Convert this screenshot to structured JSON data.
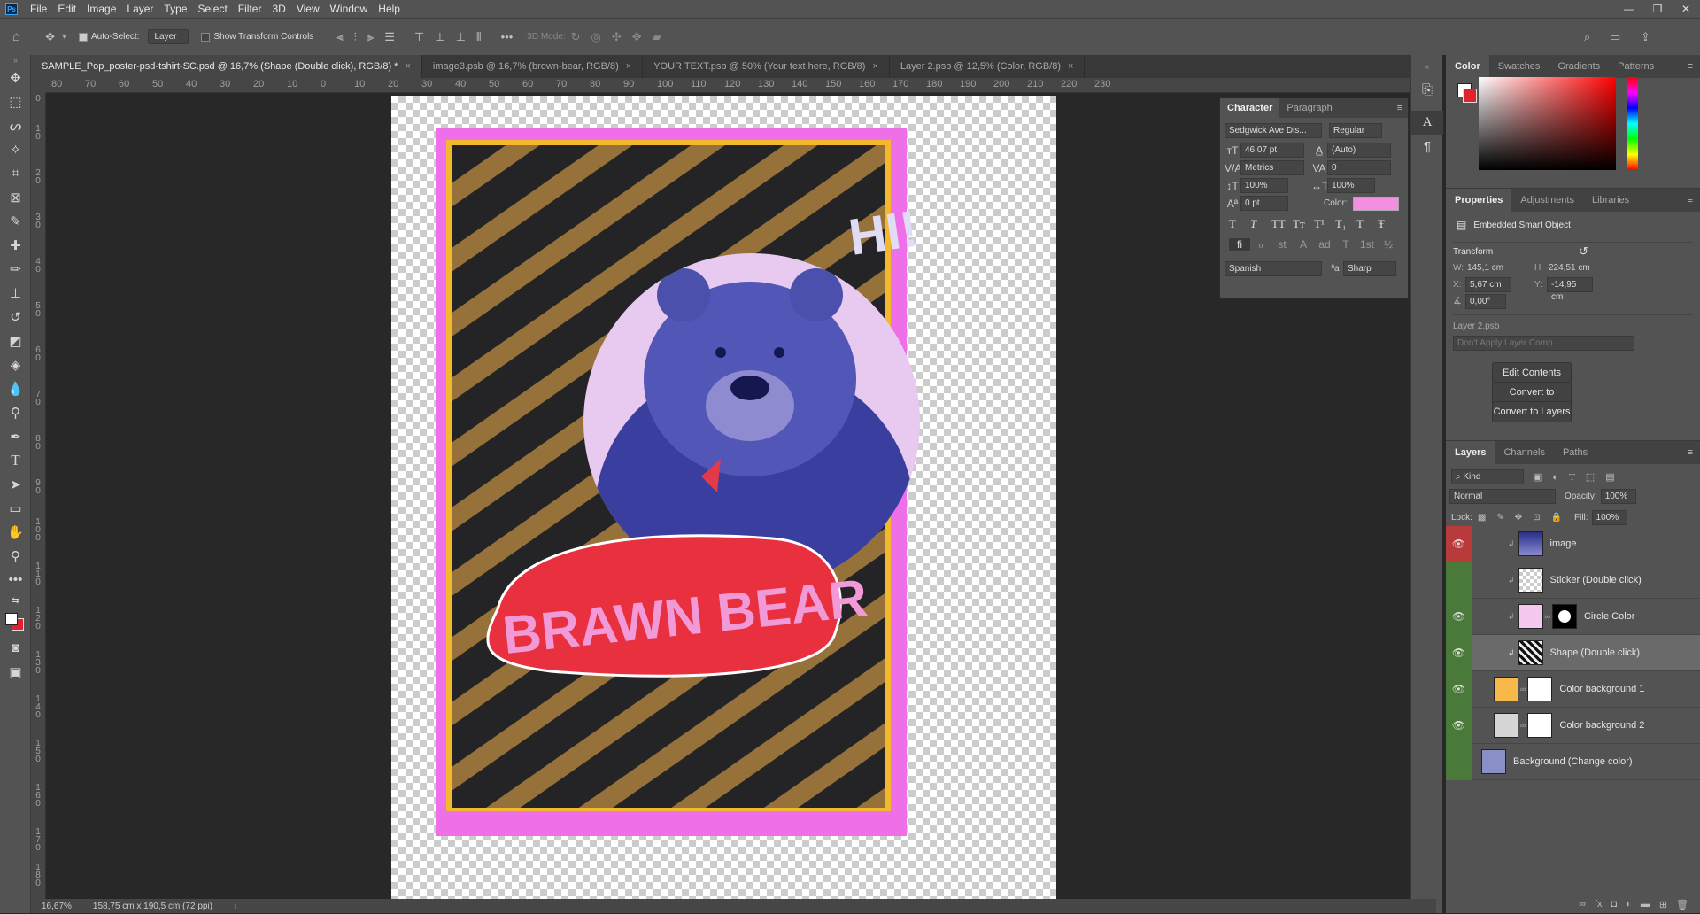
{
  "app": {
    "logo": "Ps"
  },
  "menu": [
    "File",
    "Edit",
    "Image",
    "Layer",
    "Type",
    "Select",
    "Filter",
    "3D",
    "View",
    "Window",
    "Help"
  ],
  "window_controls": [
    "—",
    "❐",
    "✕"
  ],
  "options": {
    "auto_select_label": "Auto-Select:",
    "auto_select_value": "Layer",
    "transform_controls_label": "Show Transform Controls",
    "mode_3d_label": "3D Mode:"
  },
  "doc_tabs": [
    {
      "title": "SAMPLE_Pop_poster-psd-tshirt-SC.psd @ 16,7% (Shape (Double click), RGB/8) *"
    },
    {
      "title": "image3.psb @ 16,7% (brown-bear, RGB/8)"
    },
    {
      "title": "YOUR TEXT.psb @ 50% (Your text here, RGB/8)"
    },
    {
      "title": "Layer 2.psb @ 12,5% (Color, RGB/8)"
    }
  ],
  "ruler_h_ticks": [
    "80",
    "70",
    "60",
    "50",
    "40",
    "30",
    "20",
    "10",
    "0",
    "10",
    "20",
    "30",
    "40",
    "50",
    "60",
    "70",
    "80",
    "90",
    "100",
    "110",
    "120",
    "130",
    "140",
    "150",
    "160",
    "170",
    "180",
    "190",
    "200",
    "210",
    "220",
    "230"
  ],
  "ruler_v_ticks": [
    "0",
    "10",
    "20",
    "30",
    "40",
    "50",
    "60",
    "70",
    "80",
    "90",
    "100",
    "110",
    "120",
    "130",
    "140",
    "150",
    "160",
    "170",
    "180"
  ],
  "poster": {
    "greeting": "HI!",
    "bubble_text": "BRAWN BEAR"
  },
  "status": {
    "zoom": "16,67%",
    "dimensions": "158,75 cm x 190,5 cm (72 ppi)"
  },
  "character_panel": {
    "tabs": [
      "Character",
      "Paragraph"
    ],
    "font_family": "Sedgwick Ave Dis...",
    "font_style": "Regular",
    "font_size": "46,07 pt",
    "leading": "(Auto)",
    "kerning": "Metrics",
    "tracking": "0",
    "vertical_scale": "100%",
    "horizontal_scale": "100%",
    "baseline_shift": "0 pt",
    "color_label": "Color:",
    "color_value": "#f28fe0",
    "style_buttons": [
      "T",
      "T",
      "TT",
      "Tт",
      "T¹",
      "T₁",
      "T",
      "Ŧ"
    ],
    "opentype_buttons": [
      "fi",
      "ℴ",
      "st",
      "A",
      "ad",
      "T",
      "1st",
      "½"
    ],
    "language": "Spanish",
    "aa_label": "ªa",
    "antialias": "Sharp"
  },
  "color_panel": {
    "tabs": [
      "Color",
      "Swatches",
      "Gradients",
      "Patterns"
    ],
    "foreground": "#ffffff",
    "background": "#e3202e"
  },
  "properties_panel": {
    "tabs": [
      "Properties",
      "Adjustments",
      "Libraries"
    ],
    "type": "Embedded Smart Object",
    "transform_label": "Transform",
    "w_label": "W:",
    "w_value": "145,1 cm",
    "h_label": "H:",
    "h_value": "224,51 cm",
    "x_label": "X:",
    "x_value": "5,67 cm",
    "y_label": "Y:",
    "y_value": "-14,95 cm",
    "angle_value": "0,00°",
    "file_name": "Layer 2.psb",
    "layer_comp": "Don't Apply Layer Comp",
    "buttons": [
      "Edit Contents",
      "Convert to Linked...",
      "Convert to Layers"
    ]
  },
  "layers_panel": {
    "tabs": [
      "Layers",
      "Channels",
      "Paths"
    ],
    "filter_kind": "Kind",
    "blend_mode": "Normal",
    "opacity_label": "Opacity:",
    "opacity": "100%",
    "lock_label": "Lock:",
    "fill_label": "Fill:",
    "fill": "100%",
    "layers": [
      {
        "name": "image",
        "visible": true
      },
      {
        "name": "Sticker (Double click)",
        "visible": false
      },
      {
        "name": "Circle Color",
        "visible": true
      },
      {
        "name": "Shape (Double click)",
        "visible": true
      },
      {
        "name": "Color background 1",
        "visible": true
      },
      {
        "name": "Color background 2",
        "visible": true
      },
      {
        "name": "Background (Change color)",
        "visible": false
      }
    ]
  }
}
